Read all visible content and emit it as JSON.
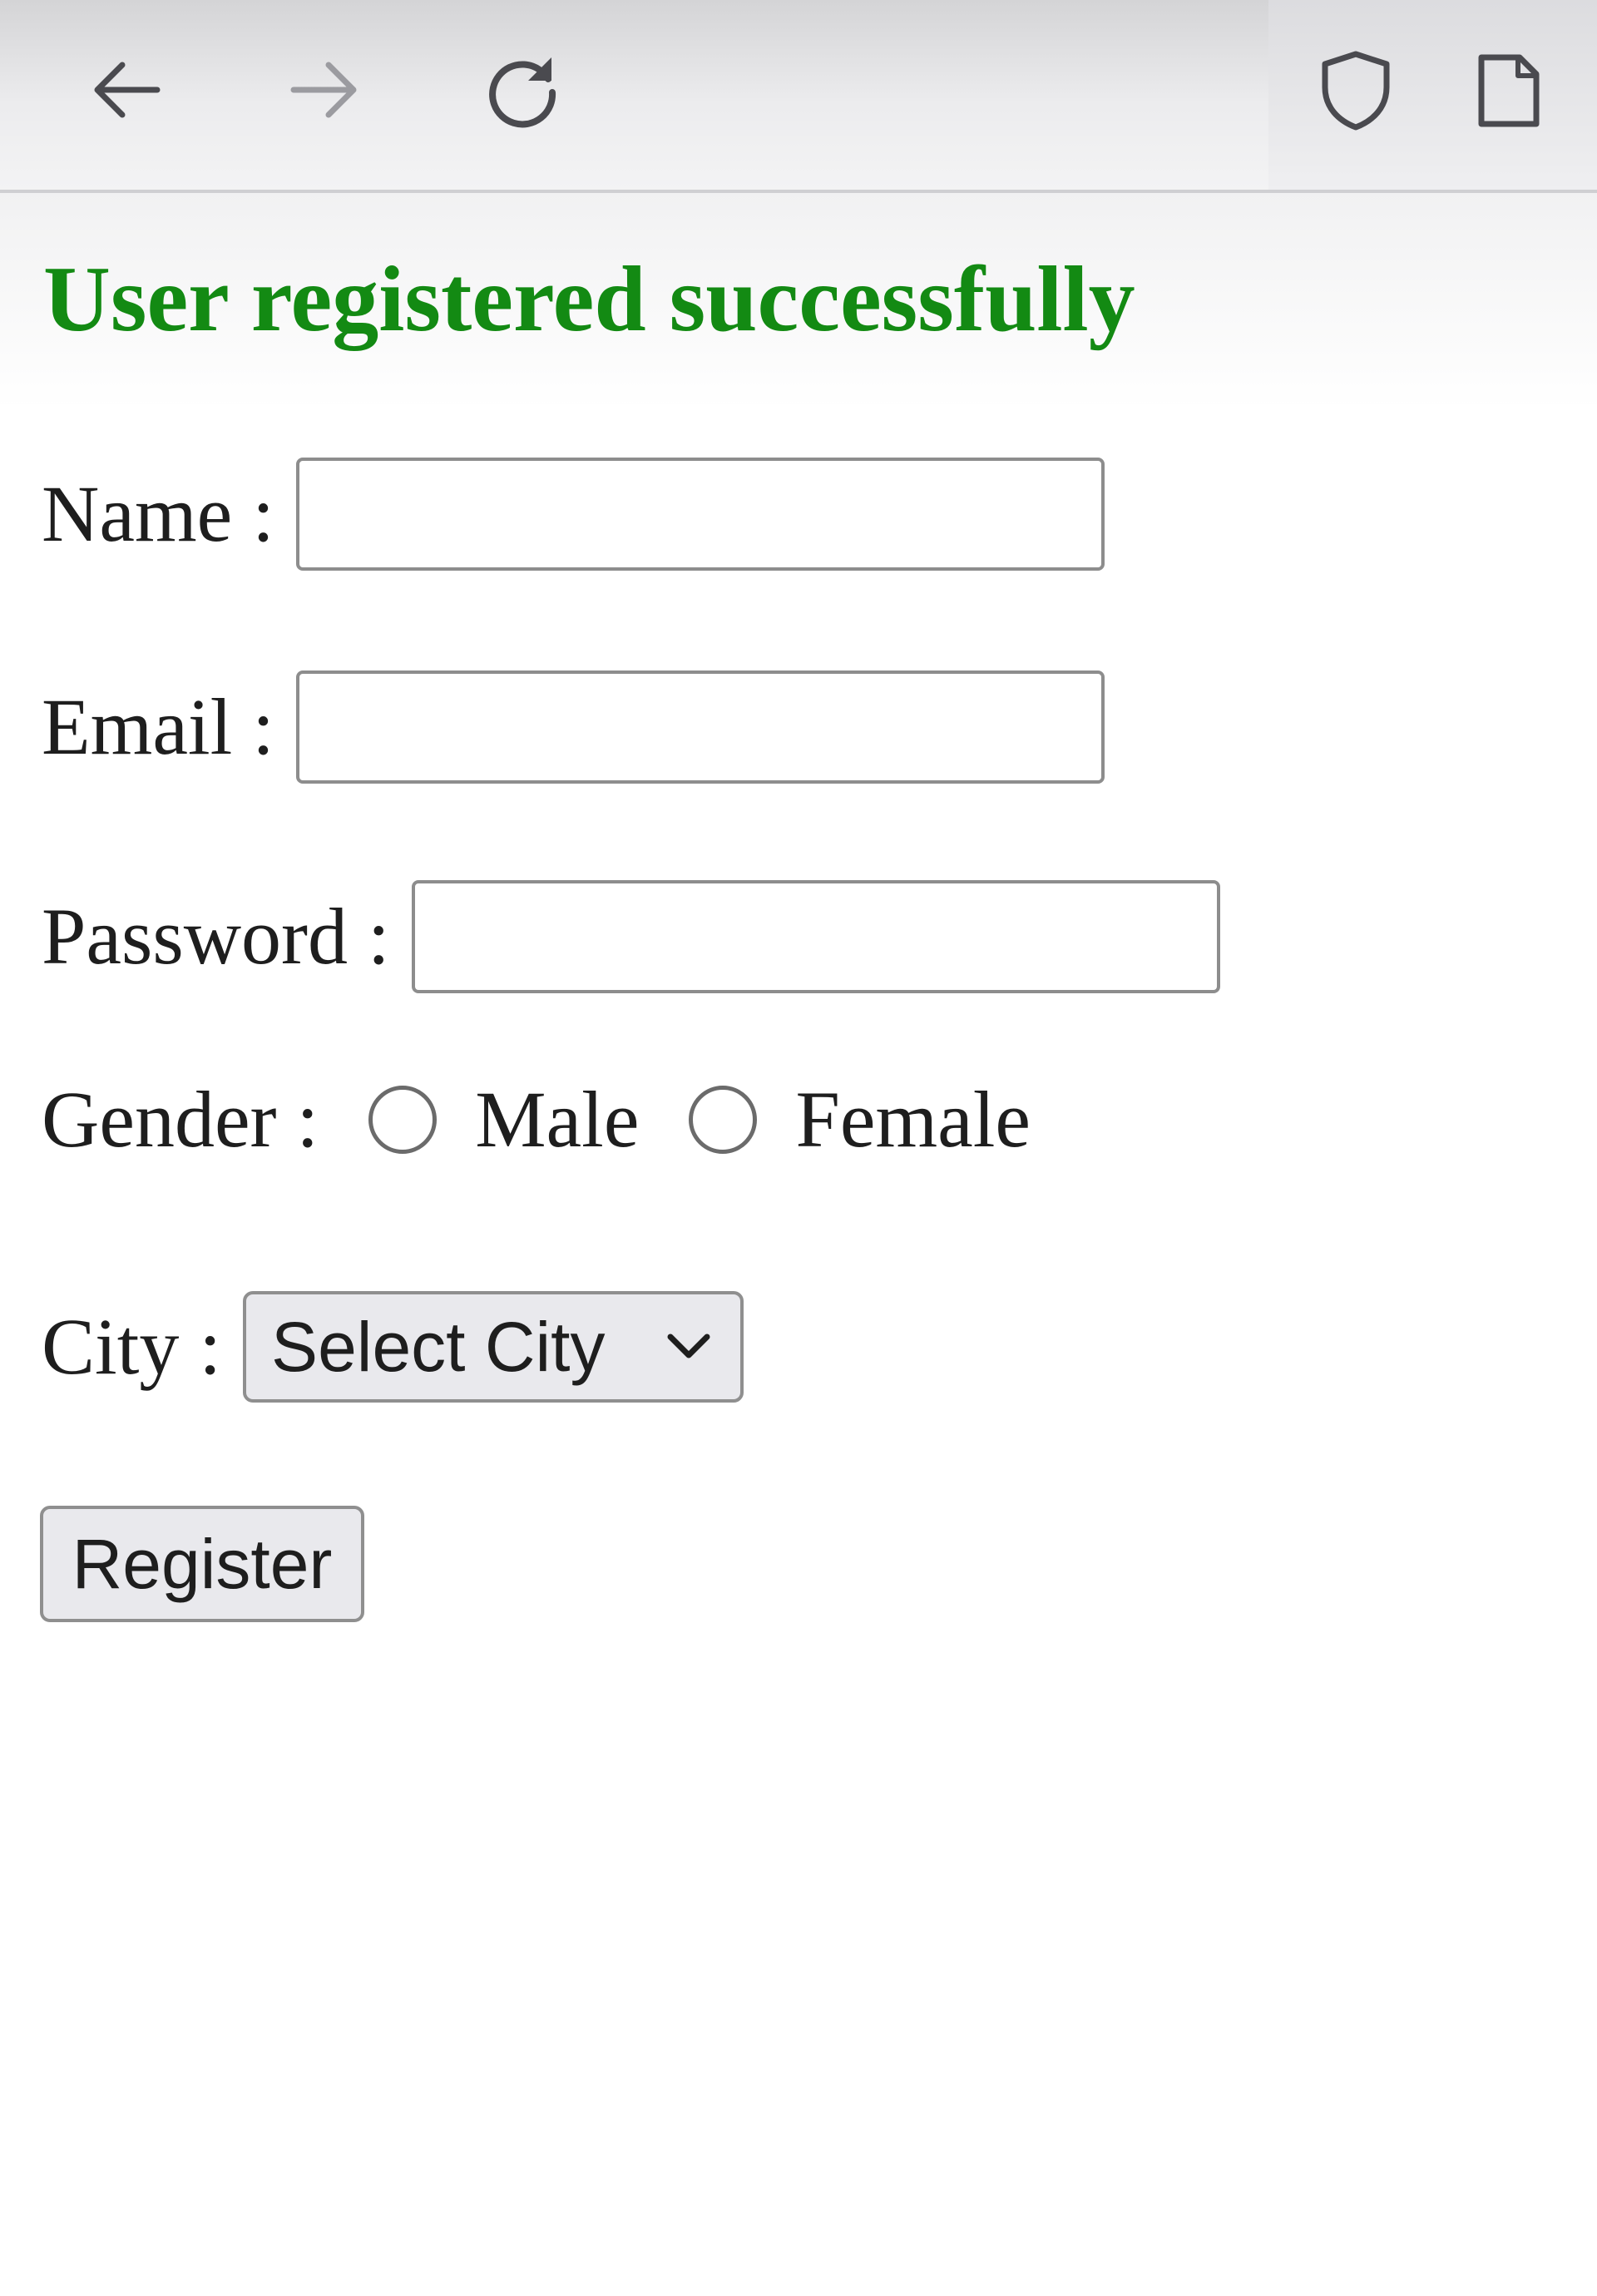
{
  "toolbar": {
    "back_icon": "arrow-left-icon",
    "forward_icon": "arrow-right-icon",
    "reload_icon": "reload-icon",
    "shield_icon": "shield-icon",
    "page_icon": "page-icon"
  },
  "message": {
    "text": "User registered successfully",
    "color": "#138a13"
  },
  "form": {
    "name_label": "Name :",
    "name_value": "",
    "email_label": "Email :",
    "email_value": "",
    "password_label": "Password :",
    "password_value": "",
    "gender_label": "Gender :",
    "gender_options": [
      "Male",
      "Female"
    ],
    "city_label": "City :",
    "city_selected": "Select City",
    "submit_label": "Register"
  }
}
